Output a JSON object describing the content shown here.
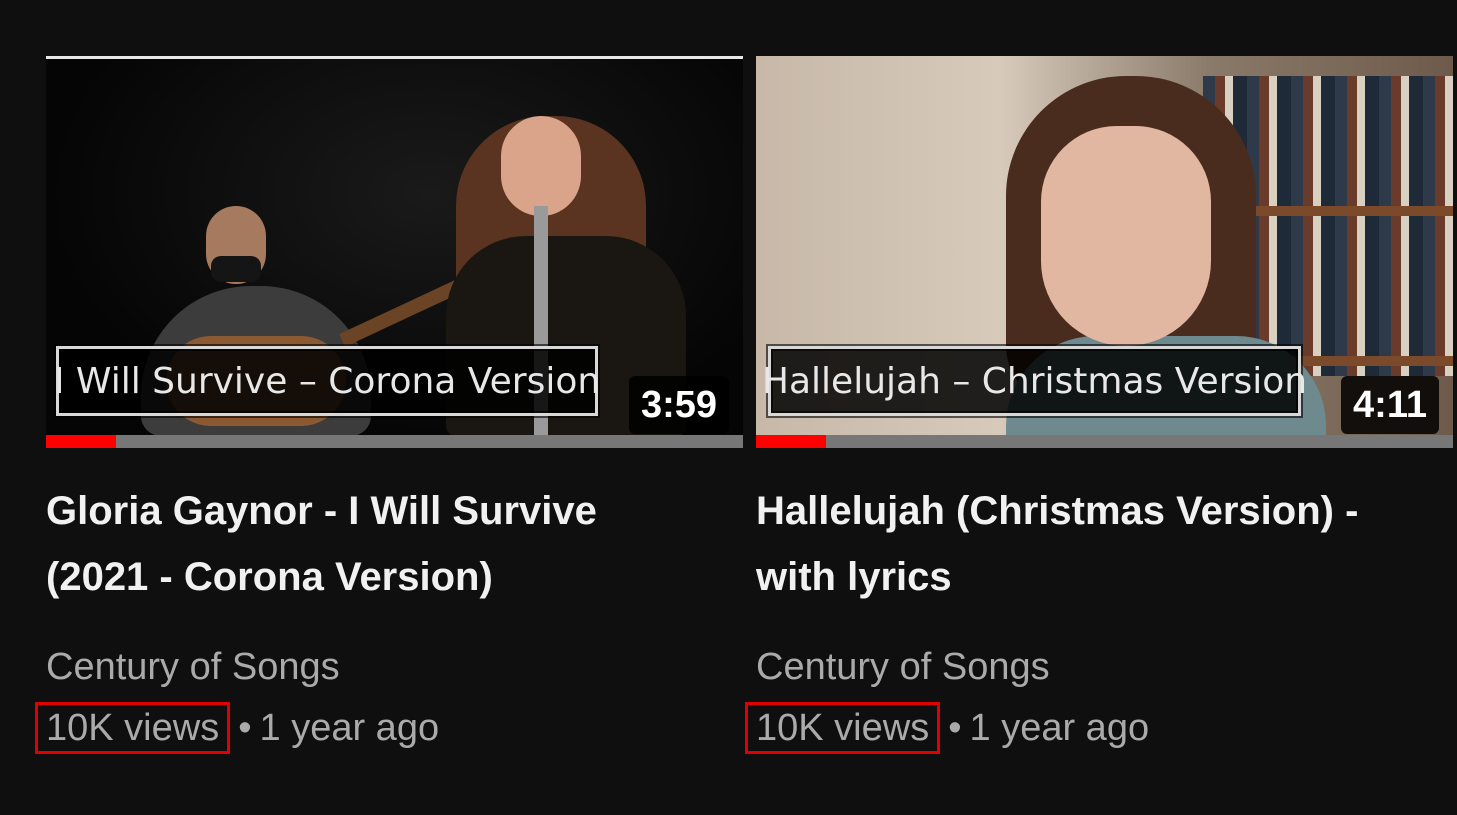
{
  "videos": [
    {
      "thumbnail_text": "I Will Survive – Corona Version",
      "duration": "3:59",
      "progress_percent": 10,
      "title": "Gloria Gaynor - I Will Survive (2021 - Corona Version)",
      "channel": "Century of Songs",
      "views": "10K views",
      "separator": "•",
      "age": "1 year ago"
    },
    {
      "thumbnail_text": "Hallelujah – Christmas Version",
      "duration": "4:11",
      "progress_percent": 10,
      "title": "Hallelujah (Christmas Version) - with lyrics",
      "channel": "Century of Songs",
      "views": "10K views",
      "separator": "•",
      "age": "1 year ago"
    }
  ],
  "colors": {
    "background": "#0f0f0f",
    "progress": "#ff0000",
    "highlight_box": "#e00000"
  }
}
